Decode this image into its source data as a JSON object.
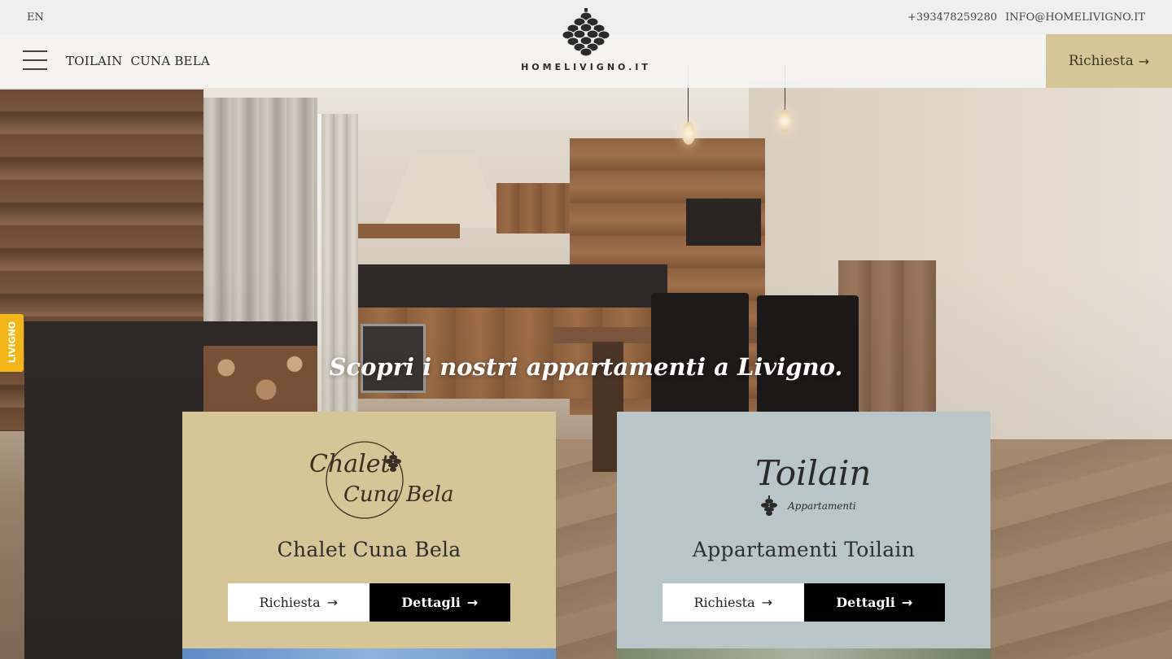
{
  "topbar": {
    "language": "EN",
    "phone": "+393478259280",
    "email": "INFO@HOMELIVIGNO.IT"
  },
  "nav": {
    "links": [
      "TOILAIN",
      "CUNA BELA"
    ],
    "cta_label": "Richiesta",
    "cta_arrow": "→"
  },
  "logo": {
    "text": "HOMELIVIGNO.IT"
  },
  "side_badge": {
    "text": "LIVIGNO"
  },
  "hero": {
    "headline": "Scopri i nostri appartamenti a Livigno."
  },
  "cards": [
    {
      "brand_line1": "Chalet",
      "brand_line2": "Cuna Bela",
      "title": "Chalet Cuna Bela",
      "request_label": "Richiesta",
      "details_label": "Dettagli",
      "arrow": "→"
    },
    {
      "brand_line1": "Toilain",
      "brand_line2": "Appartamenti",
      "title": "Appartamenti Toilain",
      "request_label": "Richiesta",
      "details_label": "Dettagli",
      "arrow": "→"
    }
  ],
  "colors": {
    "gold": "#d6c596",
    "slate": "#b9c6c9",
    "badge": "#f2b619"
  }
}
